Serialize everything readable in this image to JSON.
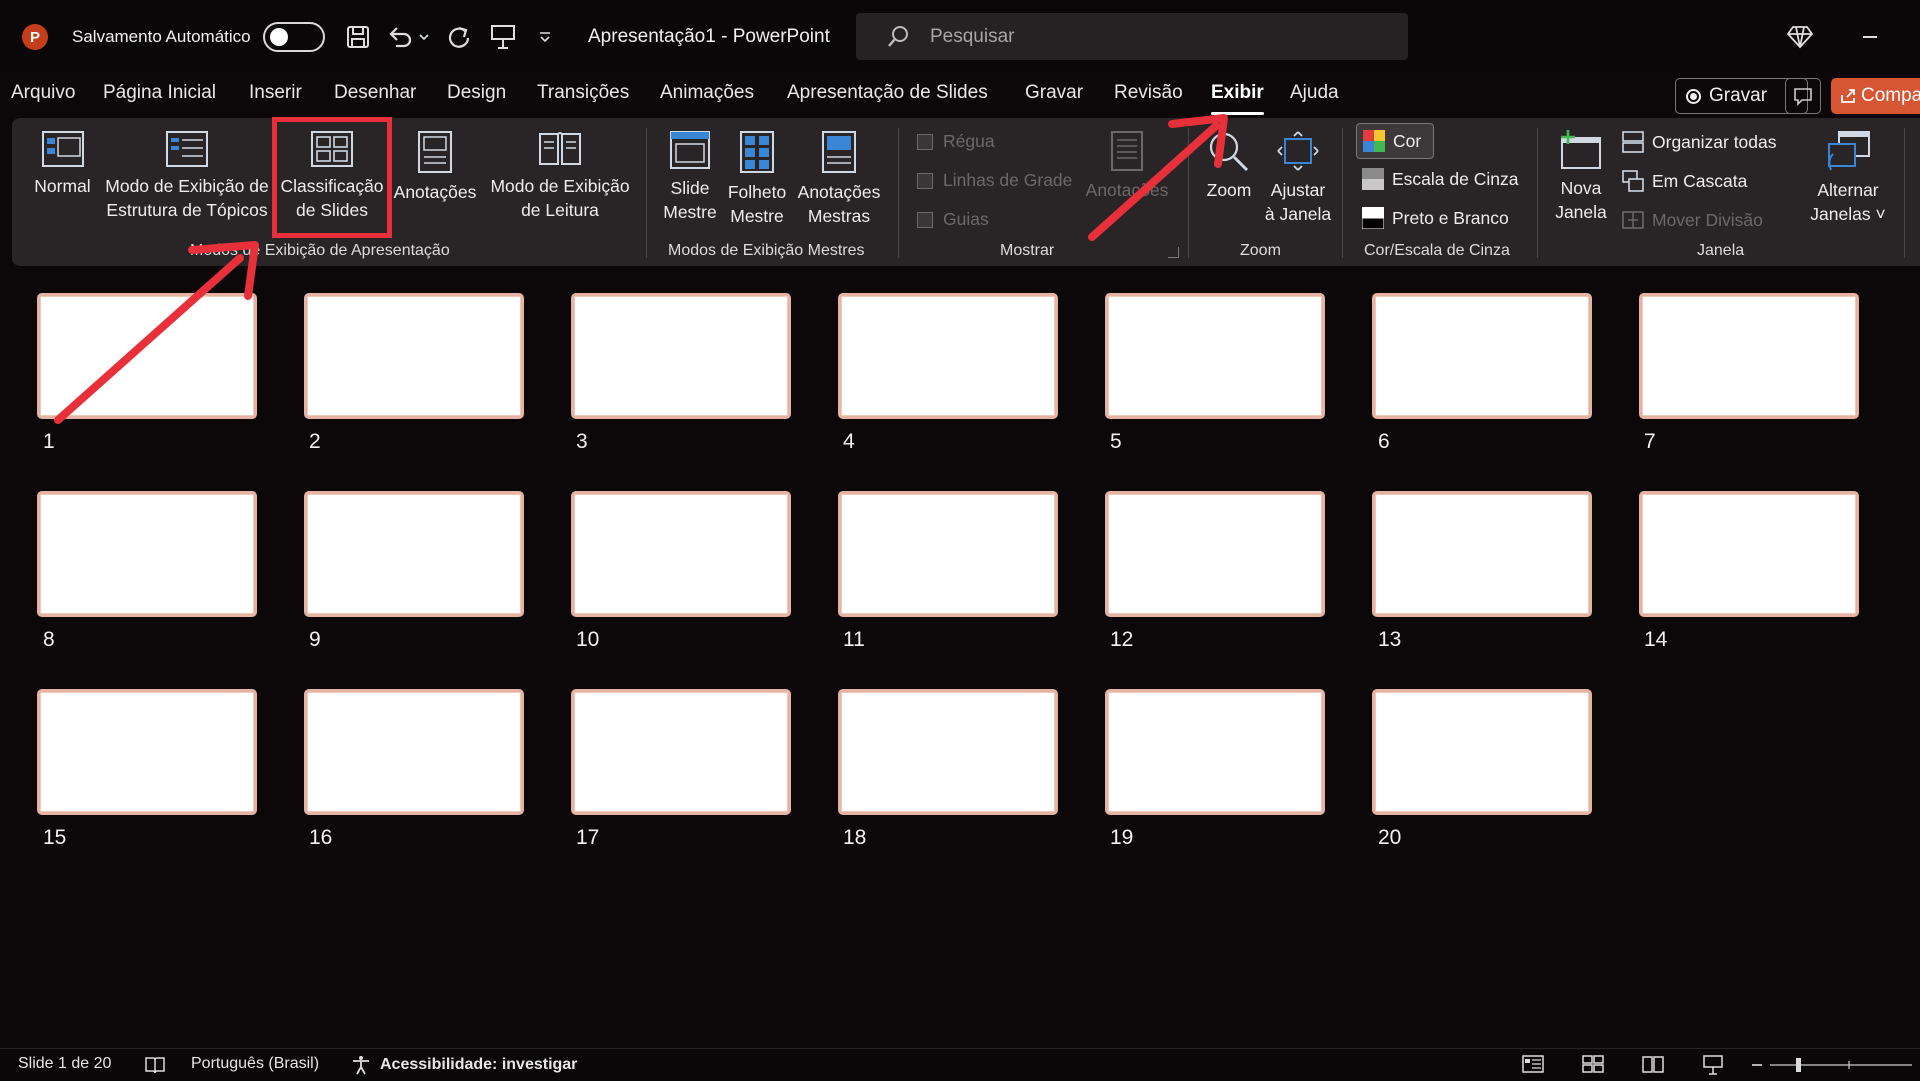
{
  "titlebar": {
    "app_logo": "P",
    "autosave_label": "Salvamento Automático",
    "autosave_state": "off",
    "doc_title": "Apresentação1  -  PowerPoint",
    "search_placeholder": "Pesquisar",
    "icons": [
      "save-icon",
      "undo-icon",
      "redo-icon",
      "present-icon",
      "customize-qat-icon",
      "diamond-icon",
      "minimize-icon"
    ]
  },
  "menu": {
    "tabs": [
      "Arquivo",
      "Página Inicial",
      "Inserir",
      "Desenhar",
      "Design",
      "Transições",
      "Animações",
      "Apresentação de Slides",
      "Gravar",
      "Revisão",
      "Exibir",
      "Ajuda"
    ],
    "active_tab": "Exibir",
    "record_label": "Gravar",
    "share_label": "Compa"
  },
  "ribbon": {
    "presentation_views": {
      "label": "Modos de Exibição de Apresentação",
      "normal": "Normal",
      "outline_1": "Modo de Exibição de",
      "outline_2": "Estrutura de Tópicos",
      "sorter_1": "Classificação",
      "sorter_2": "de Slides",
      "notes": "Anotações",
      "reading_1": "Modo de Exibição",
      "reading_2": "de Leitura"
    },
    "master_views": {
      "label": "Modos de Exibição Mestres",
      "slide_master_1": "Slide",
      "slide_master_2": "Mestre",
      "handout_master_1": "Folheto",
      "handout_master_2": "Mestre",
      "notes_master_1": "Anotações",
      "notes_master_2": "Mestras"
    },
    "show": {
      "label": "Mostrar",
      "ruler": "Régua",
      "gridlines": "Linhas de Grade",
      "guides": "Guias",
      "notes": "Anotações"
    },
    "zoom": {
      "label": "Zoom",
      "zoom": "Zoom",
      "fit_1": "Ajustar",
      "fit_2": "à Janela"
    },
    "color": {
      "label": "Cor/Escala de Cinza",
      "color": "Cor",
      "grayscale": "Escala de Cinza",
      "bw": "Preto e Branco"
    },
    "window": {
      "label": "Janela",
      "new_1": "Nova",
      "new_2": "Janela",
      "arrange": "Organizar todas",
      "cascade": "Em Cascata",
      "split": "Mover Divisão",
      "switch_1": "Alternar",
      "switch_2": "Janelas ˅"
    }
  },
  "slides": [
    "1",
    "2",
    "3",
    "4",
    "5",
    "6",
    "7",
    "8",
    "9",
    "10",
    "11",
    "12",
    "13",
    "14",
    "15",
    "16",
    "17",
    "18",
    "19",
    "20"
  ],
  "status": {
    "slide_info": "Slide 1 de 20",
    "language": "Português (Brasil)",
    "accessibility": "Acessibilidade: investigar"
  },
  "colors": {
    "accent": "#d65532",
    "annotation": "#e8303b",
    "slide_border": "#e5b3a3"
  }
}
